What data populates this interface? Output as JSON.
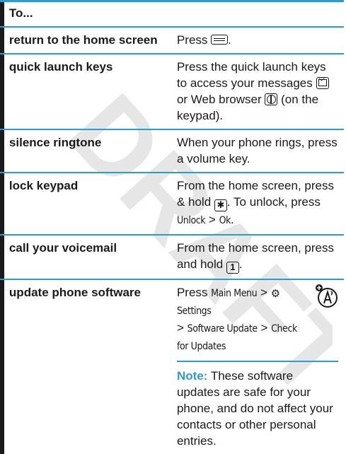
{
  "watermark": "DRAFT",
  "header": {
    "label": "To..."
  },
  "rows": [
    {
      "key": "return to the home screen",
      "pre": "Press",
      "post": "."
    },
    {
      "key": "quick launch keys",
      "text1": "Press the quick launch keys to access your messages",
      "text2": "or Web browser",
      "text3": "(on the keypad)."
    },
    {
      "key": "silence ringtone",
      "text": "When your phone rings, press a volume key."
    },
    {
      "key": "lock keypad",
      "text1": "From the home screen, press & hold",
      "key_label": "✱",
      "text2": ". To unlock, press",
      "unlock": "Unlock",
      "sep": ">",
      "ok": "Ok",
      "end": "."
    },
    {
      "key": "call your voicemail",
      "text1": "From the home screen, press and hold",
      "key_label": "1",
      "end": "."
    },
    {
      "key": "update phone software",
      "press": "Press",
      "path": [
        "Main Menu",
        ">",
        "Settings",
        ">",
        "Software Update",
        ">",
        "Check for Updates"
      ],
      "note_label": "Note:",
      "note_text": "These software updates are safe for your phone, and do not affect your contacts or other personal entries."
    }
  ],
  "icons": {
    "home": "home-key-icon",
    "message": "message-key-icon",
    "web": "web-browser-key-icon",
    "gear": "settings-gear-icon",
    "badge": "network-update-icon"
  },
  "colors": {
    "accent": "#2c9bd4",
    "watermark": "#e8e8e8"
  }
}
